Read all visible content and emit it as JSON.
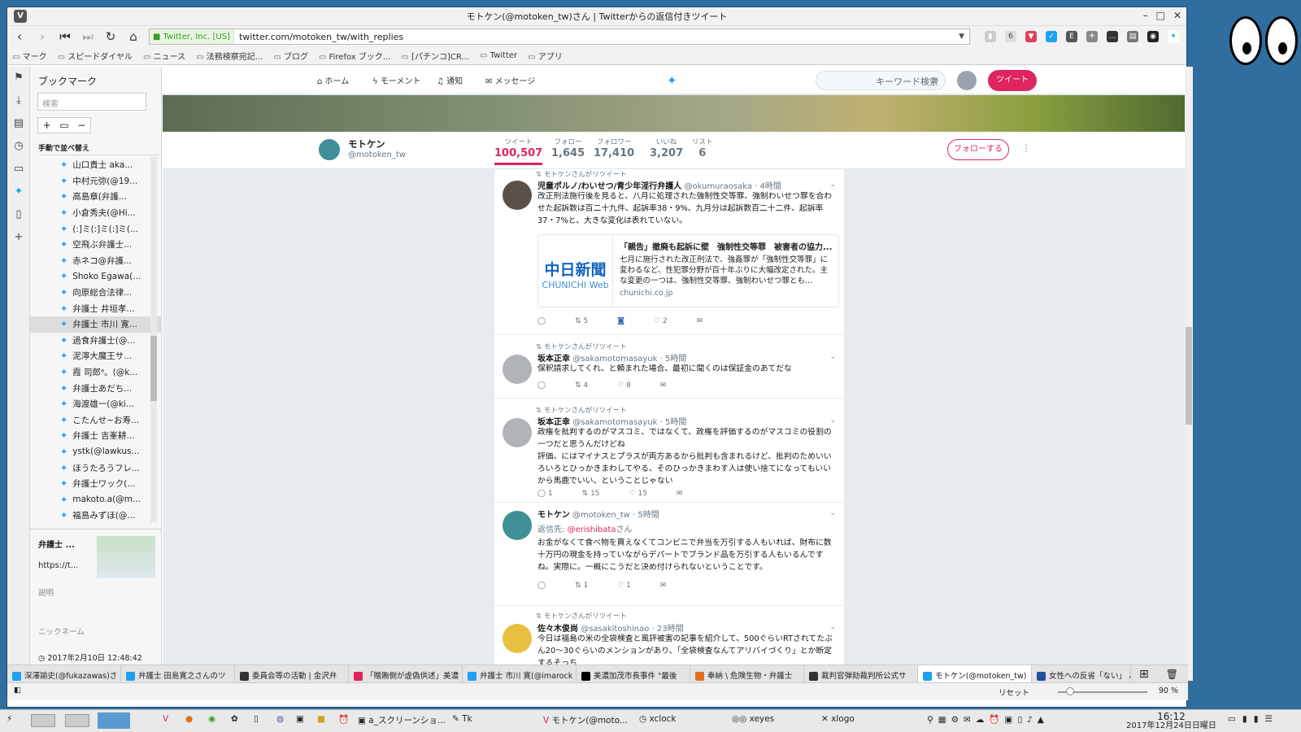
{
  "window": {
    "title": "モトケン(@motoken_tw)さん | Twitterからの返信付きツイート"
  },
  "address": {
    "security": "Twitter, Inc. [US]",
    "url": "twitter.com/motoken_tw/with_replies"
  },
  "bookmarks_bar": [
    "マーク",
    "スピードダイヤル",
    "ニュース",
    "法務検察宛記...",
    "ブログ",
    "Firefox ブック...",
    "[パチンコ]CR...",
    "Twitter",
    "アプリ"
  ],
  "bookmark_panel": {
    "title": "ブックマーク",
    "search_placeholder": "検索",
    "sort_label": "手動で並べ替え",
    "items": [
      "山口貴士 aka...",
      "中村元弥(@19...",
      "高島章(弁護...",
      "小倉秀夫(@Hi...",
      "(:]ミ(:]ミ(:]ミ(...",
      "空飛ぶ弁護士...",
      "赤ネコ@弁護...",
      "Shoko Egawa(...",
      "向原総合法律...",
      "弁護士 井垣孝...",
      "弁護士 市川 寛...",
      "過食弁護士(@...",
      "泥濘大魔王サ...",
      "霞 司郎ᵃ。(@k...",
      "弁護士あだち...",
      "海渡雄一(@ki...",
      "こたんせ~お寿...",
      "弁護士 吉峯耕...",
      "ystk(@lawkus...",
      "ほうたろうフレ...",
      "弁護士ワック(...",
      "makoto.a(@m...",
      "福島みずほ(@..."
    ],
    "selected_index": 10,
    "detail": {
      "title": "弁護士 ...",
      "url": "https://t...",
      "desc_label": "説明",
      "nick_label": "ニックネーム",
      "date": "2017年2月10日 12:48:42"
    }
  },
  "twitter": {
    "nav": {
      "home": "ホーム",
      "moments": "モーメント",
      "notifications": "通知",
      "messages": "メッセージ"
    },
    "search_placeholder": "キーワード検索",
    "tweet_button": "ツイート",
    "profile": {
      "name": "モトケン",
      "handle": "@motoken_tw",
      "follow_button": "フォローする"
    },
    "stats": [
      {
        "label": "ツイート",
        "value": "100,507"
      },
      {
        "label": "フォロー",
        "value": "1,645"
      },
      {
        "label": "フォロワー",
        "value": "17,410"
      },
      {
        "label": "いいね",
        "value": "3,207"
      },
      {
        "label": "リスト",
        "value": "6"
      }
    ],
    "tweets": [
      {
        "retweet": "モトケンさんがリツイート",
        "name": "児童ポルノ/わいせつ/青少年淫行弁護人",
        "handle": "@okumuraosaka",
        "time": "· 4時間",
        "text": "改正刑法施行後を見ると、八月に処理された強制性交等罪、強制わいせつ罪を合わせた起訴数は百二十九件、起訴率38・9%、九月分は起訴数百二十二件、起訴率37・7%と、大きな変化は表れていない。",
        "card": {
          "logo1": "中日新聞",
          "logo2": "CHUNICHI Web",
          "title": "「親告」撤廃も起訴に壁　強制性交等罪　被害者の協力...",
          "desc": "七月に施行された改正刑法で、強姦罪が「強制性交等罪」に変わるなど、性犯罪分野が百十年ぶりに大幅改定された。主な変更の一つは、強制性交等罪、強制わいせつ罪とも...",
          "url": "chunichi.co.jp"
        },
        "replies": "",
        "retweets": "5",
        "likes": "2"
      },
      {
        "retweet": "モトケンさんがリツイート",
        "name": "坂本正幸",
        "handle": "@sakamotomasayuk",
        "time": "· 5時間",
        "text": "保釈請求してくれ、と頼まれた場合、最初に聞くのは保証金のあてだな",
        "replies": "",
        "retweets": "4",
        "likes": "8"
      },
      {
        "retweet": "モトケンさんがリツイート",
        "name": "坂本正幸",
        "handle": "@sakamotomasayuk",
        "time": "· 5時間",
        "text": "政権を批判するのがマスコミ、ではなくて、政権を評価するのがマスコミの役割の一つだと思うんだけどね\n評価、にはマイナスとプラスが両方あるから批判も含まれるけど、批判のためいいろいろとひっかきまわしてやる、そのひっかきまわす人は使い捨てになってもいいから馬鹿でいい、ということじゃない",
        "replies": "1",
        "retweets": "15",
        "likes": "15"
      },
      {
        "retweet": "",
        "name": "モトケン",
        "handle": "@motoken_tw",
        "time": "· 5時間",
        "reply_prefix": "返信先: ",
        "reply_to": "@erishibata",
        "reply_suffix": "さん",
        "text": "お金がなくて食べ物を買えなくてコンビニで弁当を万引する人もいれば、財布に数十万円の現金を持っていながらデパートでブランド品を万引する人もいるんですね。実際に。一概にこうだと決め付けられないということです。",
        "replies": "",
        "retweets": "1",
        "likes": "1"
      },
      {
        "retweet": "モトケンさんがリツイート",
        "name": "佐々木俊尚",
        "handle": "@sasakitoshinao",
        "time": "· 23時間",
        "text": "今日は福島の米の全袋検査と風評被害の記事を紹介して、500ぐらいRTされてたぶん20〜30ぐらいのメンションがあり、「全袋検査なんてアリバイづくり」とか断定するそっち"
      }
    ]
  },
  "tabs": [
    "深澤諭史(@fukazawas)さ",
    "弁護士 田島寛之さんのツ",
    "委員会等の活動 | 金沢弁",
    "「贈賄側が虚偽供述」美濃",
    "弁護士 市川 寛(@imarock",
    "美濃加茂市長事件 \"最後",
    "奉納 \\ 危険生物・弁護士",
    "裁判官弾劾裁判所公式サ",
    "モトケン(@motoken_tw)",
    "女性への反省「ない」 あ"
  ],
  "status": {
    "reset": "リセット",
    "zoom": "90 %"
  },
  "taskbar": {
    "items": [
      "a_スクリーンショ...",
      "Tk",
      "モトケン(@moto...",
      "xclock",
      "xeyes",
      "xlogo"
    ],
    "time": "16:12",
    "date": "2017年12月24日日曜日"
  },
  "colors": {
    "twitter_blue": "#1da1f2",
    "twitter_pink": "#e0245e"
  }
}
